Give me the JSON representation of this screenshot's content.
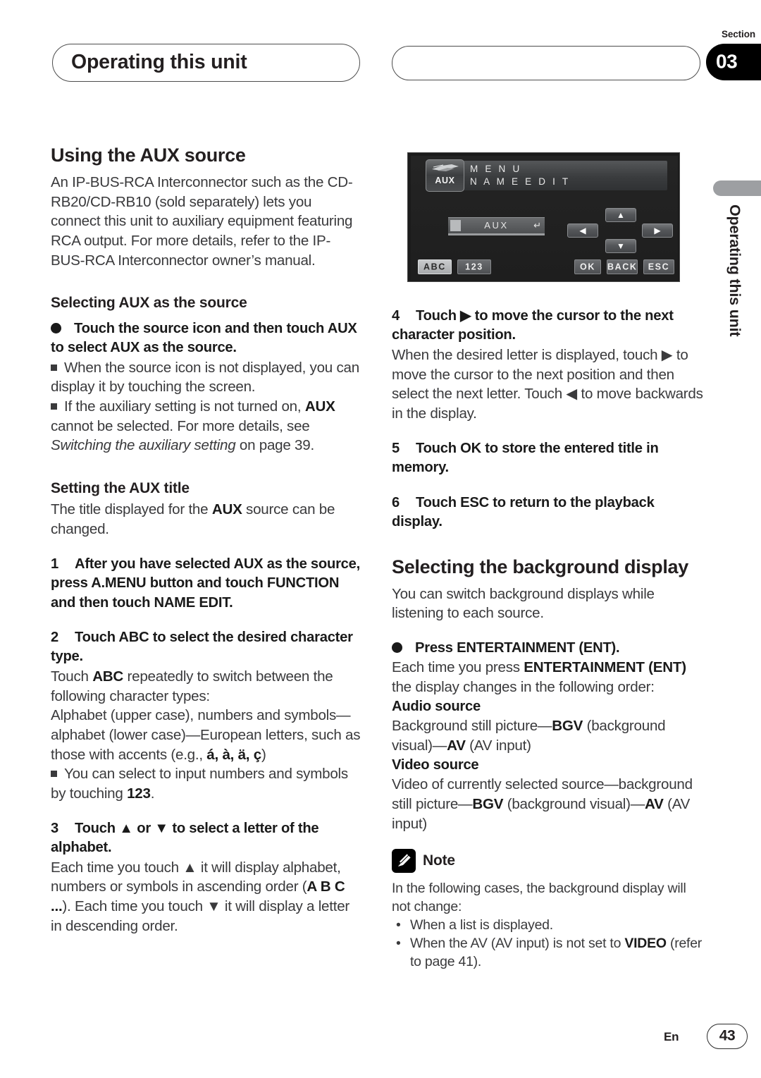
{
  "header": {
    "title": "Operating this unit",
    "section_label": "Section",
    "section_number": "03"
  },
  "side_tab": {
    "text": "Operating this unit"
  },
  "device_screen": {
    "badge": "AUX",
    "menu_line_1": "M E N U",
    "menu_line_2": "N A M E   E D I T",
    "field_value": "AUX",
    "enter_glyph": "↵",
    "arrow_up": "▲",
    "arrow_down": "▼",
    "arrow_left": "◀",
    "arrow_right": "▶",
    "btn_abc": "ABC",
    "btn_123": "123",
    "btn_ok": "OK",
    "btn_back": "BACK",
    "btn_esc": "ESC"
  },
  "left_column": {
    "heading_1": "Using the AUX source",
    "intro": "An IP-BUS-RCA Interconnector such as the CD-RB20/CD-RB10 (sold separately) lets you connect this unit to auxiliary equipment featuring RCA output. For more details, refer to the IP-BUS-RCA Interconnector owner’s manual.",
    "sub_heading_1": "Selecting AUX as the source",
    "bullet_1": "Touch the source icon and then touch AUX to select AUX as the source.",
    "note_1": "When the source icon is not displayed, you can display it by touching the screen.",
    "note_2a": "If the auxiliary setting is not turned on, ",
    "note_2b": "AUX",
    "note_2c": " cannot be selected. For more details, see ",
    "note_2d": "Switching the auxiliary setting",
    "note_2e": " on page 39.",
    "sub_heading_2": "Setting the AUX title",
    "para_2a": "The title displayed for the ",
    "para_2b": "AUX",
    "para_2c": " source can be changed.",
    "step_1_num": "1",
    "step_1": "After you have selected AUX as the source, press A.MENU button and touch FUNCTION and then touch NAME EDIT.",
    "step_2_num": "2",
    "step_2": "Touch ABC to select the desired character type.",
    "step_2_body_a": "Touch ",
    "step_2_body_b": "ABC",
    "step_2_body_c": " repeatedly to switch between the following character types:",
    "step_2_body_d": "Alphabet (upper case), numbers and symbols—alphabet (lower case)—European letters, such as those with accents (e.g., ",
    "step_2_accents": "á, à, ä, ç",
    "step_2_body_e": ")",
    "step_2_note_a": "You can select to input numbers and symbols by touching ",
    "step_2_note_b": "123",
    "step_2_note_c": ".",
    "step_3_num": "3",
    "step_3": "Touch ▲ or ▼ to select a letter of the alphabet.",
    "step_3_body_a": "Each time you touch ▲ it will display alphabet, numbers or symbols in ascending order (",
    "step_3_body_b": "A B C ...",
    "step_3_body_c": "). Each time you touch ▼ it will display a letter in descending order."
  },
  "right_column": {
    "step_4_num": "4",
    "step_4": "Touch ▶ to move the cursor to the next character position.",
    "step_4_body": "When the desired letter is displayed, touch ▶ to move the cursor to the next position and then select the next letter. Touch ◀ to move backwards in the display.",
    "step_5_num": "5",
    "step_5": "Touch OK to store the entered title in memory.",
    "step_6_num": "6",
    "step_6": "Touch ESC to return to the playback display.",
    "heading_2": "Selecting the background display",
    "para_3": "You can switch background displays while listening to each source.",
    "bullet_2": "Press ENTERTAINMENT (ENT).",
    "para_4a": "Each time you press ",
    "para_4b": "ENTERTAINMENT (ENT)",
    "para_4c": " the display changes in the following order:",
    "audio_label": "Audio source",
    "audio_a": "Background still picture—",
    "audio_b": "BGV",
    "audio_c": " (background visual)—",
    "audio_d": "AV",
    "audio_e": " (AV input)",
    "video_label": "Video source",
    "video_a": "Video of currently selected source—background still picture—",
    "video_b": "BGV",
    "video_c": " (background visual)—",
    "video_d": "AV",
    "video_e": " (AV input)",
    "note_label": "Note",
    "note_intro": "In the following cases, the background display will not change:",
    "note_bullet_1": "When a list is displayed.",
    "note_bullet_2a": "When the AV (AV input) is not set to ",
    "note_bullet_2b": "VIDEO",
    "note_bullet_2c": " (refer to page 41)."
  },
  "footer": {
    "language": "En",
    "page_number": "43"
  }
}
